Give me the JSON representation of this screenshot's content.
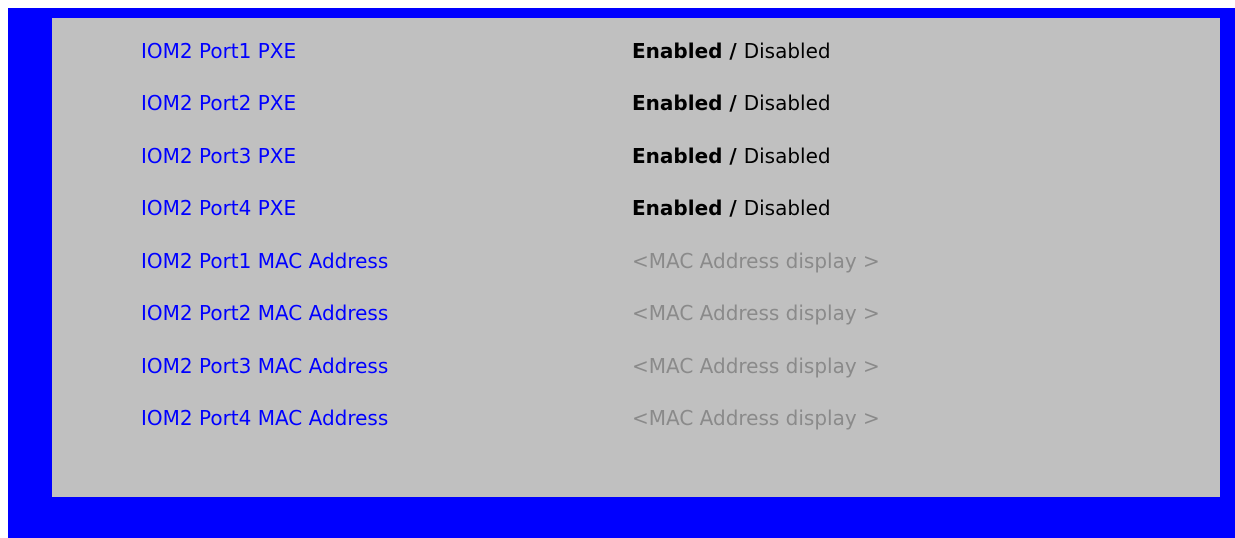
{
  "rows": [
    {
      "label": "IOM2 Port1 PXE",
      "enabled": "Enabled",
      "separator": " / ",
      "disabled": "Disabled"
    },
    {
      "label": "IOM2 Port2 PXE",
      "enabled": "Enabled",
      "separator": " / ",
      "disabled": "Disabled"
    },
    {
      "label": "IOM2 Port3 PXE",
      "enabled": "Enabled",
      "separator": " / ",
      "disabled": "Disabled"
    },
    {
      "label": "IOM2 Port4 PXE",
      "enabled": "Enabled",
      "separator": " / ",
      "disabled": "Disabled"
    },
    {
      "label": "IOM2 Port1 MAC Address",
      "value": "<MAC Address display >"
    },
    {
      "label": "IOM2 Port2 MAC Address",
      "value": "<MAC Address display >"
    },
    {
      "label": "IOM2 Port3 MAC Address",
      "value": "<MAC Address display >"
    },
    {
      "label": "IOM2 Port4 MAC Address",
      "value": "<MAC Address display >"
    }
  ],
  "colors": {
    "frame": "#0000ff",
    "panel": "#c0c0c0",
    "label": "#0000ff",
    "value_active": "#000000",
    "value_readonly": "#8a8a8a"
  }
}
